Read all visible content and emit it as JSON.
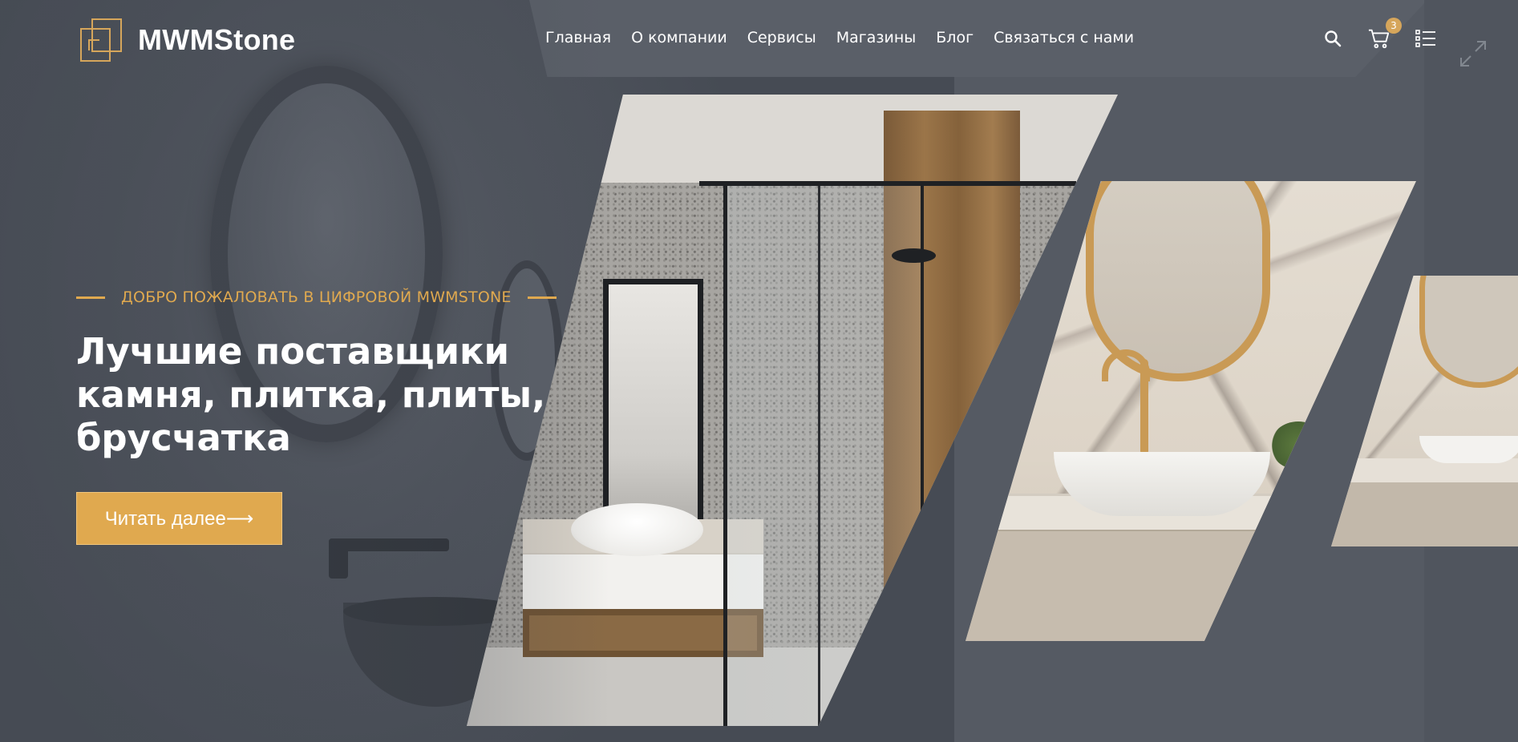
{
  "brand": {
    "name": "MWMStone"
  },
  "nav": {
    "items": [
      {
        "label": "Главная"
      },
      {
        "label": "О компании"
      },
      {
        "label": "Сервисы"
      },
      {
        "label": "Магазины"
      },
      {
        "label": "Блог"
      },
      {
        "label": "Связаться с нами"
      }
    ]
  },
  "header_icons": {
    "search": "search-icon",
    "cart": "cart-icon",
    "cart_count": "3",
    "menu": "menu-list-icon"
  },
  "hero": {
    "eyebrow": "ДОБРО ПОЖАЛОВАТЬ В ЦИФРОВОЙ MWMSTONE",
    "title": "Лучшие поставщики камня, плитка, плиты, брусчатка",
    "cta_label": "Читать далее⟶"
  },
  "colors": {
    "accent": "#e0a94f",
    "background": "#4a4f58",
    "text": "#ffffff"
  }
}
